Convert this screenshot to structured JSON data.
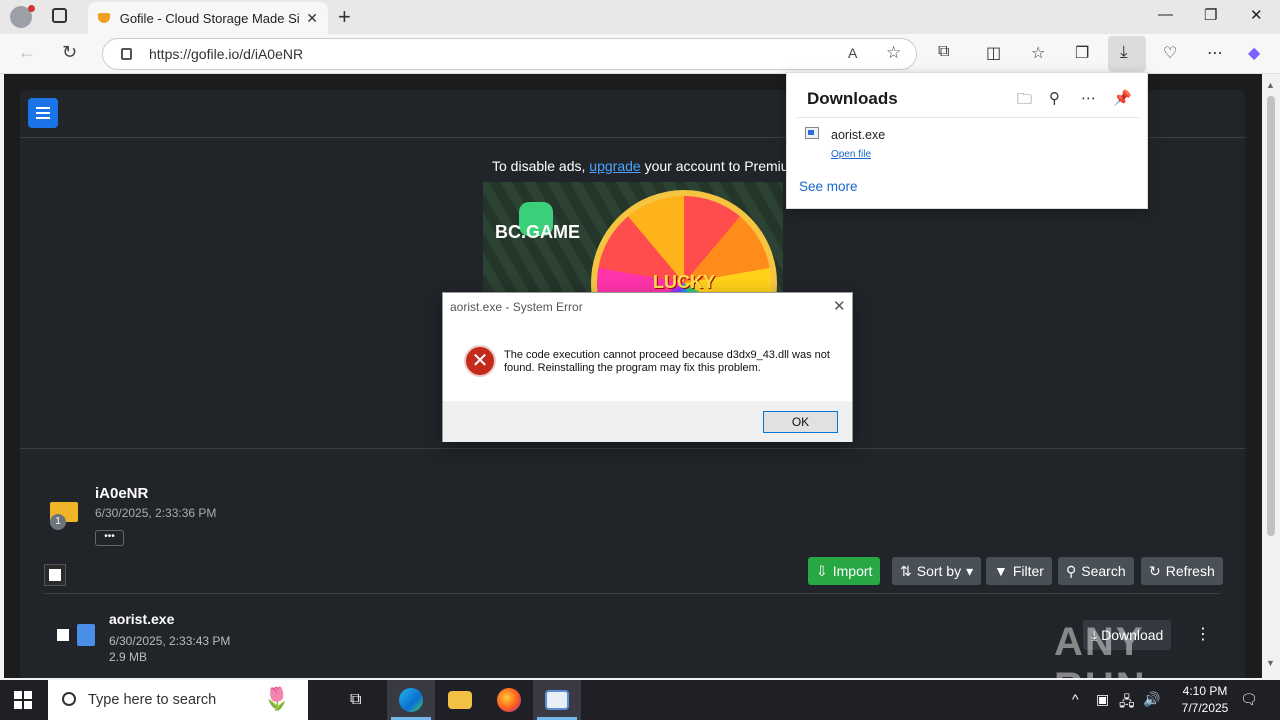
{
  "browser": {
    "tab_title": "Gofile - Cloud Storage Made Simple",
    "new_tab": "+",
    "url": "https://gofile.io/d/iA0eNR",
    "window_controls": {
      "minimize": "—",
      "restore": "❐",
      "close": "✕"
    }
  },
  "downloads_panel": {
    "title": "Downloads",
    "items": [
      {
        "name": "aorist.exe",
        "action": "Open file"
      }
    ],
    "see_more": "See more"
  },
  "page": {
    "ads_text_before": "To disable ads, ",
    "ads_link": "upgrade",
    "ads_text_after": " your account to Premium",
    "ad": {
      "brand": "BC.GAME",
      "wheel_text": "LUCKY"
    },
    "folder": {
      "name": "iA0eNR",
      "date": "6/30/2025, 2:33:36 PM",
      "badge": "1",
      "more": "•••"
    },
    "toolbar": {
      "import": "Import",
      "sort": "Sort by",
      "filter": "Filter",
      "search": "Search",
      "refresh": "Refresh"
    },
    "file": {
      "name": "aorist.exe",
      "date": "6/30/2025, 2:33:43 PM",
      "size": "2.9 MB",
      "download": "Download"
    },
    "watermark": "ANY RUN"
  },
  "dialog": {
    "title": "aorist.exe - System Error",
    "message": "The code execution cannot proceed because d3dx9_43.dll was not found. Reinstalling the program may fix this problem.",
    "ok": "OK",
    "close": "✕"
  },
  "taskbar": {
    "search_placeholder": "Type here to search",
    "time": "4:10 PM",
    "date": "7/7/2025"
  },
  "colors": {
    "accent": "#1a73e8",
    "import_green": "#28a745",
    "error_red": "#c42b1c"
  }
}
